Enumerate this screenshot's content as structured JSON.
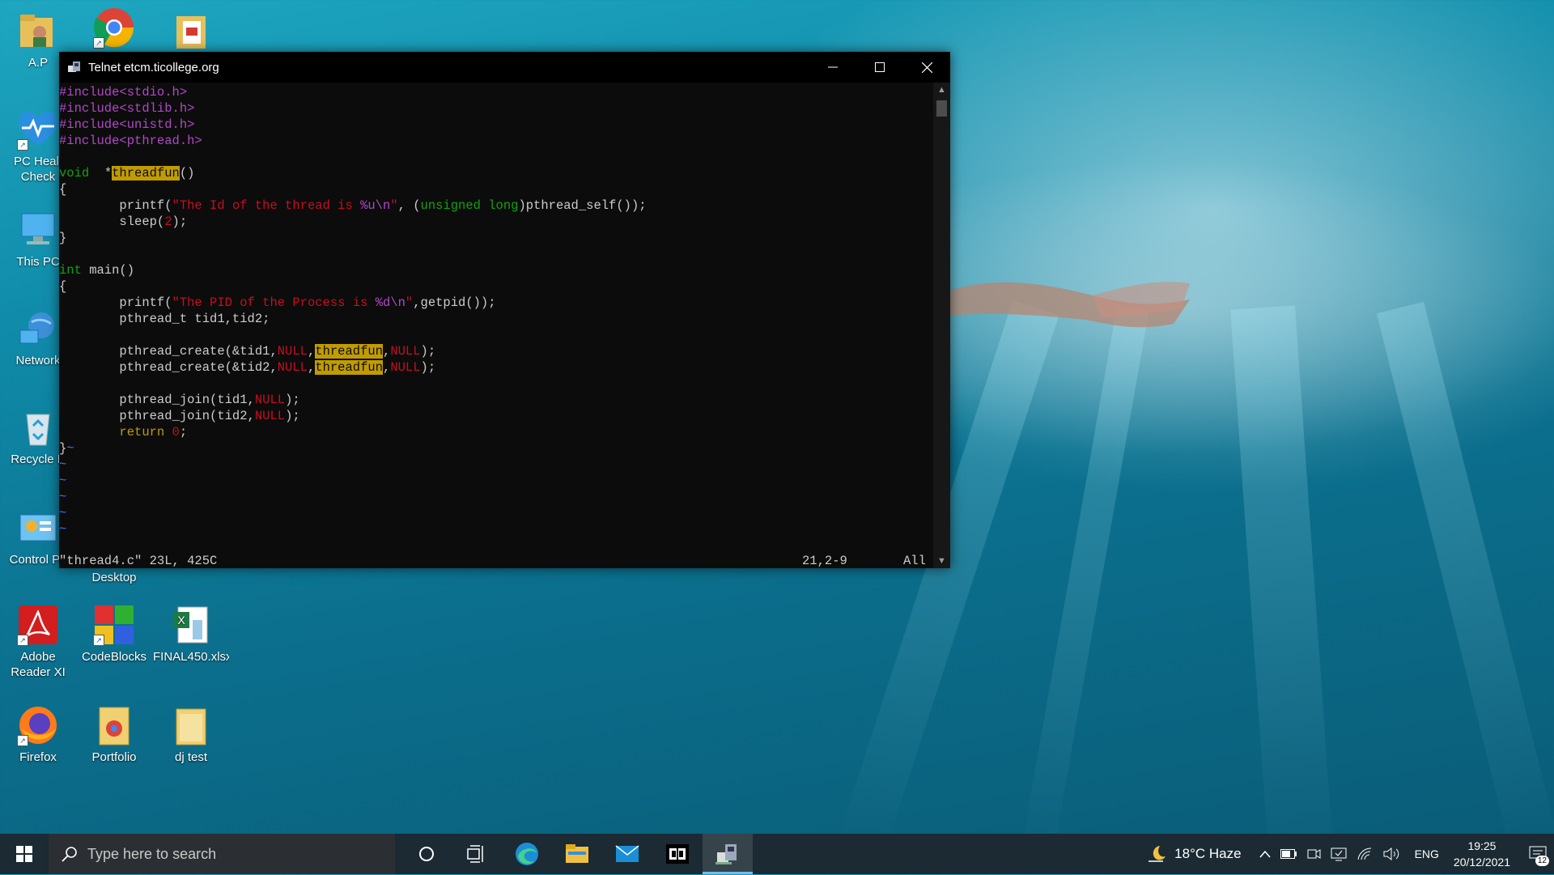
{
  "desktop": {
    "icons": [
      {
        "label": "A.P",
        "icon": "user-folder-icon"
      },
      {
        "label": "",
        "icon": "chrome-icon"
      },
      {
        "label": "",
        "icon": "documents-folder-icon"
      },
      {
        "label": "PC Healt",
        "label2": "Check",
        "icon": "pc-health-icon"
      },
      {
        "label": "This PC",
        "icon": "computer-icon"
      },
      {
        "label": "Network",
        "icon": "network-icon"
      },
      {
        "label": "Recycle B",
        "icon": "recycle-bin-icon"
      },
      {
        "label": "Control Pa",
        "icon": "control-panel-icon"
      },
      {
        "label": "Desktop",
        "icon": "desktop-folder-icon"
      },
      {
        "label": "Adobe",
        "label2": "Reader XI",
        "icon": "adobe-reader-icon"
      },
      {
        "label": "CodeBlocks",
        "icon": "codeblocks-icon"
      },
      {
        "label": "FINAL450.xlsx",
        "icon": "excel-file-icon"
      },
      {
        "label": "Firefox",
        "icon": "firefox-icon"
      },
      {
        "label": "Portfolio",
        "icon": "chrome-file-icon"
      },
      {
        "label": "dj test",
        "icon": "folder-icon"
      }
    ]
  },
  "window": {
    "title": "Telnet etcm.ticollege.org",
    "minimize_label": "—",
    "maximize_label": "☐",
    "close_label": "✕"
  },
  "editor": {
    "lines": [
      [
        [
          "pp",
          "#include<stdio.h>"
        ]
      ],
      [
        [
          "pp",
          "#include<stdlib.h>"
        ]
      ],
      [
        [
          "pp",
          "#include<unistd.h>"
        ]
      ],
      [
        [
          "pp",
          "#include<pthread.h>"
        ]
      ],
      [],
      [
        [
          "ty",
          "void"
        ],
        [
          "",
          "  *"
        ],
        [
          "hl",
          "threadfun"
        ],
        [
          "",
          "()"
        ]
      ],
      [
        [
          "",
          "{"
        ]
      ],
      [
        [
          "",
          "        printf("
        ],
        [
          "st",
          "\"The Id of the thread is "
        ],
        [
          "fm",
          "%u\\n"
        ],
        [
          "st",
          "\""
        ],
        [
          "",
          ", ("
        ],
        [
          "ty",
          "unsigned long"
        ],
        [
          "",
          ")pthread_self());"
        ]
      ],
      [
        [
          "",
          "        sleep("
        ],
        [
          "nm",
          "2"
        ],
        [
          "",
          ");"
        ]
      ],
      [
        [
          "",
          "}"
        ]
      ],
      [],
      [
        [
          "ty",
          "int"
        ],
        [
          "",
          " main()"
        ]
      ],
      [
        [
          "",
          "{"
        ]
      ],
      [
        [
          "",
          "        printf("
        ],
        [
          "st",
          "\"The PID of the Process is "
        ],
        [
          "fm",
          "%d\\n"
        ],
        [
          "st",
          "\""
        ],
        [
          "",
          ",getpid());"
        ]
      ],
      [
        [
          "",
          "        pthread_t tid1,tid2;"
        ]
      ],
      [],
      [
        [
          "",
          "        pthread_create(&tid1,"
        ],
        [
          "st",
          "NULL"
        ],
        [
          "",
          ","
        ],
        [
          "hl",
          "threadfun"
        ],
        [
          "",
          ","
        ],
        [
          "st",
          "NULL"
        ],
        [
          "",
          ");"
        ]
      ],
      [
        [
          "",
          "        pthread_create(&tid2,"
        ],
        [
          "st",
          "NULL"
        ],
        [
          "",
          ","
        ],
        [
          "hl",
          "threadfun"
        ],
        [
          "",
          ","
        ],
        [
          "st",
          "NULL"
        ],
        [
          "",
          ");"
        ]
      ],
      [],
      [
        [
          "",
          "        pthread_join(tid1,"
        ],
        [
          "st",
          "NULL"
        ],
        [
          "",
          ");"
        ]
      ],
      [
        [
          "",
          "        pthread_join(tid2,"
        ],
        [
          "st",
          "NULL"
        ],
        [
          "",
          ");"
        ]
      ],
      [
        [
          "kw",
          "        return"
        ],
        [
          "",
          " "
        ],
        [
          "nm",
          "0"
        ],
        [
          "",
          ";"
        ]
      ],
      [
        [
          "",
          "}"
        ],
        [
          "tilde",
          "~"
        ]
      ],
      [
        [
          "tilde",
          "~"
        ]
      ],
      [
        [
          "tilde",
          "~"
        ]
      ],
      [
        [
          "tilde",
          "~"
        ]
      ],
      [
        [
          "tilde",
          "~"
        ]
      ],
      [
        [
          "tilde",
          "~"
        ]
      ]
    ],
    "status_file": "\"thread4.c\" 23L, 425C",
    "status_pos": "21,2-9",
    "status_scroll": "All"
  },
  "taskbar": {
    "search_placeholder": "Type here to search",
    "apps": [
      "cortana-icon",
      "task-view-icon",
      "edge-icon",
      "file-explorer-icon",
      "mail-icon",
      "dolby-icon",
      "telnet-icon"
    ],
    "weather": "18°C  Haze",
    "language": "ENG",
    "time": "19:25",
    "date": "20/12/2021",
    "notifications": "12"
  },
  "colors": {
    "preprocessor": "#b148c6",
    "type": "#13a10e",
    "string": "#c50f1f",
    "keyword": "#c19c00",
    "highlight": "#c19c00"
  }
}
